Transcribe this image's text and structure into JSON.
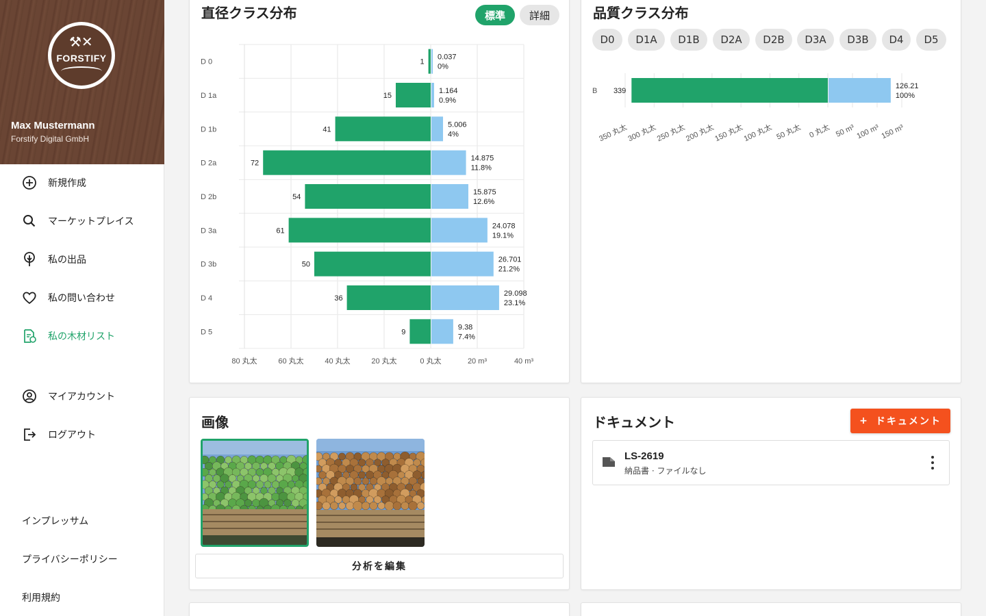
{
  "user": {
    "name": "Max Mustermann",
    "org": "Forstify Digital GmbH",
    "logo_text": "FORSTIFY"
  },
  "nav": [
    {
      "label": "新規作成",
      "icon": "add-circle-icon",
      "active": false
    },
    {
      "label": "マーケットプレイス",
      "icon": "search-icon",
      "active": false
    },
    {
      "label": "私の出品",
      "icon": "tree-pin-icon",
      "active": false
    },
    {
      "label": "私の問い合わせ",
      "icon": "heart-icon",
      "active": false
    },
    {
      "label": "私の木材リスト",
      "icon": "document-list-icon",
      "active": true
    },
    {
      "label": "マイアカウント",
      "icon": "account-circle-icon",
      "active": false
    },
    {
      "label": "ログアウト",
      "icon": "logout-icon",
      "active": false
    }
  ],
  "footer_links": [
    "インプレッサム",
    "プライバシーポリシー",
    "利用規約"
  ],
  "colors": {
    "accent": "#20a36a",
    "volume": "#8ec8f0",
    "brand_brown": "#6a4534",
    "orange": "#f4511e"
  },
  "diameter_card": {
    "title": "直径クラス分布",
    "toggle": {
      "standard": "標準",
      "detail": "詳細",
      "selected": "標準"
    }
  },
  "quality_card": {
    "title": "品質クラス分布",
    "chips": [
      "D0",
      "D1A",
      "D1B",
      "D2A",
      "D2B",
      "D3A",
      "D3B",
      "D4",
      "D5"
    ]
  },
  "images_card": {
    "title": "画像",
    "edit_button": "分析を編集"
  },
  "documents_card": {
    "title": "ドキュメント",
    "add_button": "ドキュメント",
    "items": [
      {
        "name": "LS-2619",
        "meta": "納品書 · ファイルなし"
      }
    ]
  },
  "chart_data": [
    {
      "type": "bar",
      "title": "直径クラス分布",
      "orientation": "horizontal-diverging",
      "categories": [
        "D 0",
        "D 1a",
        "D 1b",
        "D 2a",
        "D 2b",
        "D 3a",
        "D 3b",
        "D 4",
        "D 5"
      ],
      "series": [
        {
          "values": [
            1,
            15,
            41,
            72,
            54,
            61,
            50,
            36,
            9
          ],
          "color": "#20a36a"
        },
        {
          "values": [
            0.037,
            1.164,
            5.006,
            14.875,
            15.875,
            24.078,
            26.701,
            29.098,
            9.38
          ],
          "percent_labels": [
            "0%",
            "0.9%",
            "4%",
            "11.8%",
            "12.6%",
            "19.1%",
            "21.2%",
            "23.1%",
            "7.4%"
          ],
          "color": "#8ec8f0"
        }
      ],
      "left_ticks": [
        "80 丸太",
        "60 丸太",
        "40 丸太",
        "20 丸太",
        "0 丸太"
      ],
      "right_ticks": [
        "20 m³",
        "40 m³"
      ],
      "left_max": 80,
      "right_max": 40,
      "grid": true
    },
    {
      "type": "bar",
      "title": "品質クラス分布",
      "orientation": "horizontal-diverging",
      "categories": [
        "B"
      ],
      "series": [
        {
          "values": [
            339
          ],
          "color": "#20a36a"
        },
        {
          "values": [
            126.21
          ],
          "percent_labels": [
            "100%"
          ],
          "color": "#8ec8f0"
        }
      ],
      "left_ticks": [
        "350 丸太",
        "300 丸太",
        "250 丸太",
        "200 丸太",
        "150 丸太",
        "100 丸太",
        "50 丸太",
        "0 丸太"
      ],
      "right_ticks": [
        "50 m³",
        "100 m³",
        "150 m³"
      ],
      "left_max": 350,
      "right_max": 150,
      "grid": true
    }
  ]
}
